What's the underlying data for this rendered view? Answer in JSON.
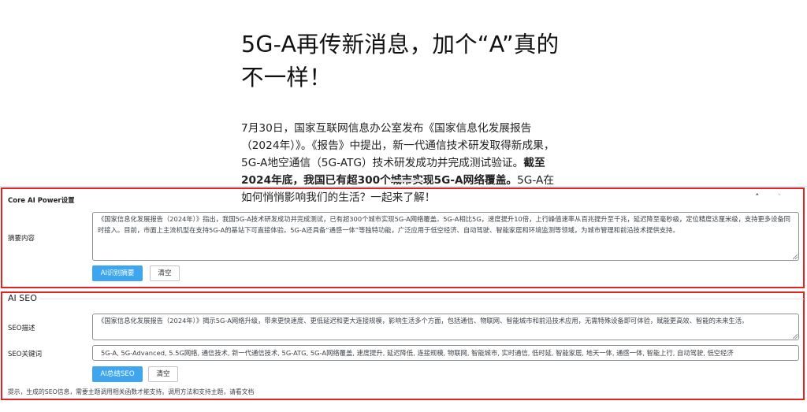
{
  "article": {
    "title": "5G-A再传新消息，加个“A”真的不一样！",
    "intro_normal": "7月30日，国家互联网信息办公室发布《国家信息化发展报告（2024年）》。《报告》中提出，新一代通信技术研发取得新成果，5G-A地空通信（5G-ATG）技术研发成功并完成测试验证。",
    "intro_bold": "截至2024年底，我国已有超300个城市实现5G-A网络覆盖。",
    "intro_tail": "5G-A在如何悄悄影响我们的生活？一起来了解！"
  },
  "core_ai": {
    "panel_title": "Core AI Power设置",
    "collapse_icon": "chevron-up-icon",
    "expand_icon": "chevron-down-icon",
    "summary_label": "摘要内容",
    "summary_value": "《国家信息化发展报告（2024年）》指出，我国5G-A技术研发成功并完成测试，已有超300个城市实现5G-A网络覆盖。5G-A相比5G，速度提升10倍，上行峰值速率从百兆提升至千兆，延迟降至毫秒级，定位精度达厘米级，支持更多设备同时接入。目前，市面上主流机型在支持5G-A的基站下可直接体验。5G-A还具备“通感一体”等独特功能，广泛应用于低空经济、自动驾驶、智能家居和环境监测等领域，为城市管理和前沿技术提供支持。",
    "identify_button": "AI识别摘要",
    "clear_button": "清空"
  },
  "ai_seo": {
    "section_title": "AI SEO",
    "description_label": "SEO描述",
    "description_value": "《国家信息化发展报告（2024年）》揭示5G-A网络升级，带来更快速度、更低延迟和更大连接规模，影响生活多个方面，包括通信、物联网、智能城市和前沿技术应用，无需特殊设备即可体验，赋能更高效、智能的未来生活。",
    "keywords_label": "SEO关键词",
    "keywords_value": "5G-A, 5G-Advanced, 5.5G网络, 通信技术, 新一代通信技术, 5G-ATG, 5G-A网络覆盖, 速度提升, 延迟降低, 连接规模, 物联网, 智能城市, 实时通信, 低时延, 智能家居, 地天一体, 通感一体, 智能上行, 自动驾驶, 低空经济",
    "summarize_button": "AI总结SEO",
    "clear_button": "清空",
    "hint": "提示，生成的SEO信息，需要主题调用相关函数才能支持。调用方法和支持主题，请看文档"
  },
  "colors": {
    "highlight_border": "#e02424",
    "primary_button": "#3ea6ef"
  }
}
